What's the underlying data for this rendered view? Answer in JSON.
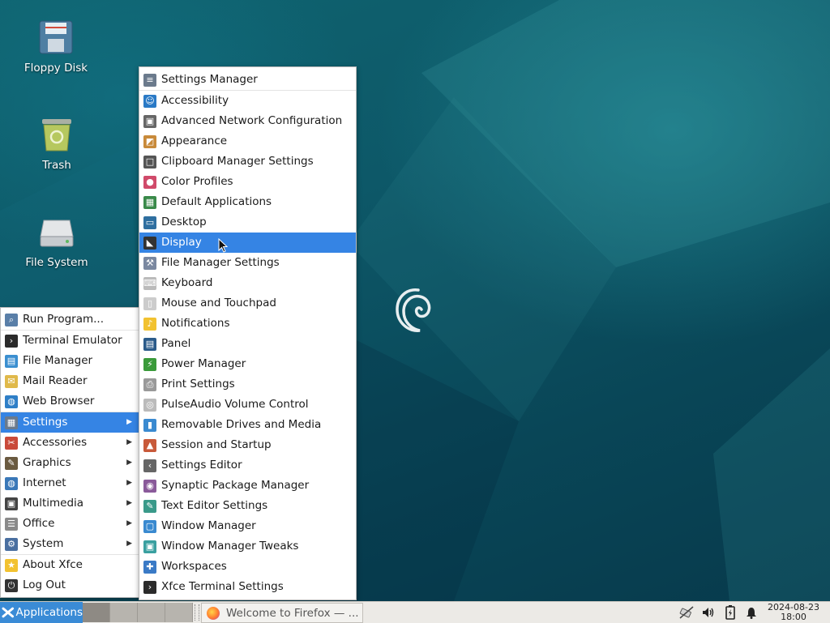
{
  "desktop": {
    "icons": [
      {
        "label": "Floppy Disk",
        "icon": "floppy-disk-icon"
      },
      {
        "label": "Trash",
        "icon": "trash-icon"
      },
      {
        "label": "File System",
        "icon": "hard-drive-icon"
      }
    ],
    "wallpaper": {
      "logo": "debian-swirl-logo",
      "colors": [
        "#0f6470",
        "#094657",
        "#073a4c"
      ]
    }
  },
  "app_menu": {
    "items": [
      {
        "label": "Run Program...",
        "icon": "run-program-icon"
      },
      {
        "label": "Terminal Emulator",
        "icon": "terminal-icon"
      },
      {
        "label": "File Manager",
        "icon": "file-manager-icon"
      },
      {
        "label": "Mail Reader",
        "icon": "mail-icon"
      },
      {
        "label": "Web Browser",
        "icon": "web-browser-icon"
      },
      {
        "label": "Settings",
        "icon": "settings-icon",
        "submenu": true,
        "active": true
      },
      {
        "label": "Accessories",
        "icon": "accessories-icon",
        "submenu": true
      },
      {
        "label": "Graphics",
        "icon": "graphics-icon",
        "submenu": true
      },
      {
        "label": "Internet",
        "icon": "internet-icon",
        "submenu": true
      },
      {
        "label": "Multimedia",
        "icon": "multimedia-icon",
        "submenu": true
      },
      {
        "label": "Office",
        "icon": "office-icon",
        "submenu": true
      },
      {
        "label": "System",
        "icon": "system-icon",
        "submenu": true
      },
      {
        "label": "About Xfce",
        "icon": "star-icon"
      },
      {
        "label": "Log Out",
        "icon": "log-out-icon"
      }
    ]
  },
  "settings_menu": {
    "items": [
      {
        "label": "Settings Manager",
        "icon": "settings-manager-icon"
      },
      {
        "label": "Accessibility",
        "icon": "accessibility-icon"
      },
      {
        "label": "Advanced Network Configuration",
        "icon": "network-icon"
      },
      {
        "label": "Appearance",
        "icon": "appearance-icon"
      },
      {
        "label": "Clipboard Manager Settings",
        "icon": "clipboard-icon"
      },
      {
        "label": "Color Profiles",
        "icon": "color-profiles-icon"
      },
      {
        "label": "Default Applications",
        "icon": "default-applications-icon"
      },
      {
        "label": "Desktop",
        "icon": "desktop-icon"
      },
      {
        "label": "Display",
        "icon": "display-icon",
        "active": true
      },
      {
        "label": "File Manager Settings",
        "icon": "file-manager-settings-icon"
      },
      {
        "label": "Keyboard",
        "icon": "keyboard-icon"
      },
      {
        "label": "Mouse and Touchpad",
        "icon": "mouse-icon"
      },
      {
        "label": "Notifications",
        "icon": "bell-icon"
      },
      {
        "label": "Panel",
        "icon": "panel-icon"
      },
      {
        "label": "Power Manager",
        "icon": "power-manager-icon"
      },
      {
        "label": "Print Settings",
        "icon": "printer-icon"
      },
      {
        "label": "PulseAudio Volume Control",
        "icon": "volume-control-icon"
      },
      {
        "label": "Removable Drives and Media",
        "icon": "removable-drive-icon"
      },
      {
        "label": "Session and Startup",
        "icon": "rocket-icon"
      },
      {
        "label": "Settings Editor",
        "icon": "settings-editor-icon"
      },
      {
        "label": "Synaptic Package Manager",
        "icon": "synaptic-icon"
      },
      {
        "label": "Text Editor Settings",
        "icon": "text-editor-icon"
      },
      {
        "label": "Window Manager",
        "icon": "window-manager-icon"
      },
      {
        "label": "Window Manager Tweaks",
        "icon": "window-tweaks-icon"
      },
      {
        "label": "Workspaces",
        "icon": "workspaces-icon"
      },
      {
        "label": "Xfce Terminal Settings",
        "icon": "terminal-settings-icon"
      }
    ]
  },
  "taskbar": {
    "applications_label": "Applications",
    "workspaces_count": 4,
    "current_workspace": 1,
    "task_label": "Welcome to Firefox — ...",
    "tray_icons": [
      "network-disconnected-icon",
      "volume-icon",
      "battery-icon",
      "notification-bell-icon"
    ],
    "clock_date": "2024-08-23",
    "clock_time": "18:00"
  },
  "colors": {
    "accent": "#3584e4",
    "panel": "#eceae6"
  }
}
